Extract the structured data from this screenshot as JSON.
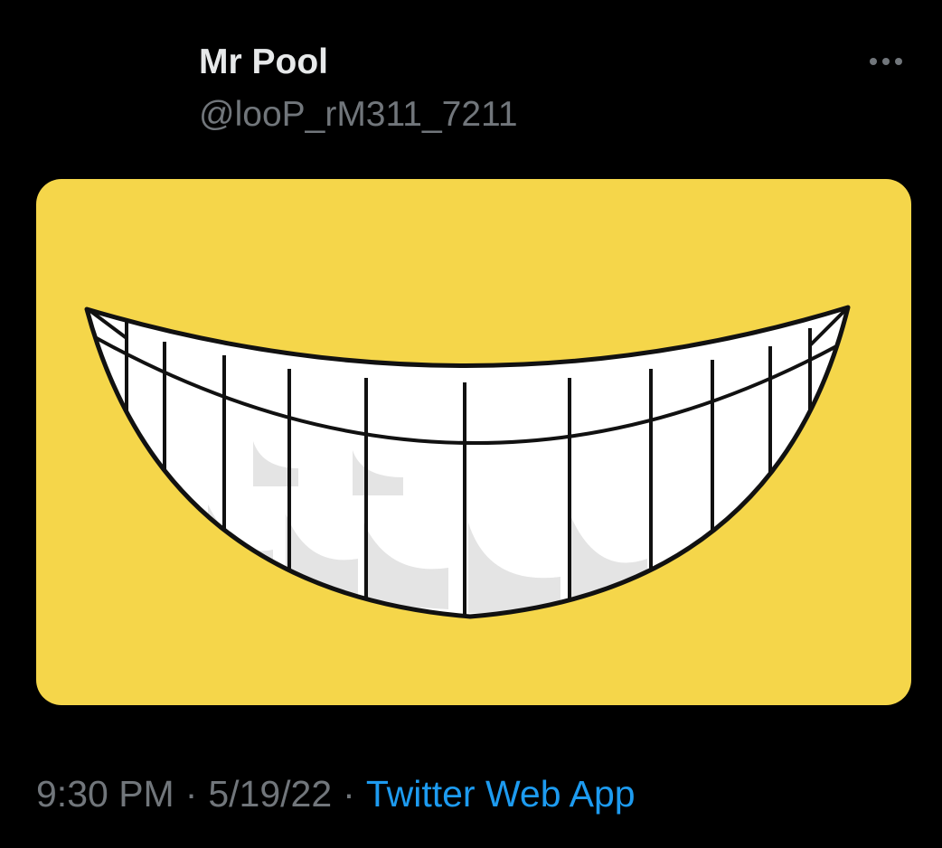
{
  "tweet": {
    "display_name": "Mr Pool",
    "handle": "@looP_rM311_7211",
    "more_icon": "more-horizontal-icon",
    "media": {
      "description_icon": "smile-teeth-image",
      "background_color": "#f5d64a"
    },
    "time": "9:30 PM",
    "separator": "·",
    "date": "5/19/22",
    "source": "Twitter Web App"
  },
  "colors": {
    "background": "#000000",
    "primary_text": "#e7e9ea",
    "secondary_text": "#71767b",
    "link": "#1d9bf0"
  }
}
